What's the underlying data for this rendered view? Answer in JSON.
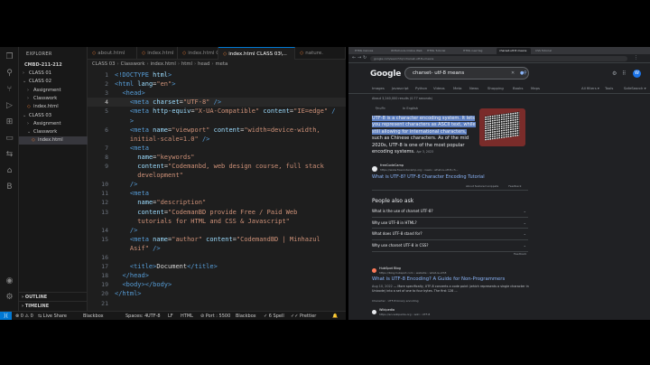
{
  "vscode": {
    "explorer_title": "EXPLORER",
    "folder_title": "CMBD-211-212",
    "tree": [
      {
        "label": "CLASS 01",
        "kind": "folder",
        "chev": "›"
      },
      {
        "label": "CLASS 02",
        "kind": "folder",
        "chev": "⌄"
      },
      {
        "label": "Assignment",
        "kind": "folder",
        "chev": "›"
      },
      {
        "label": "Classwork",
        "kind": "folder",
        "chev": "›"
      },
      {
        "label": "index.html",
        "kind": "file",
        "chev": ""
      },
      {
        "label": "CLASS 03",
        "kind": "folder",
        "chev": "⌄"
      },
      {
        "label": "Assignment",
        "kind": "folder",
        "chev": "›"
      },
      {
        "label": "Classwork",
        "kind": "folder",
        "chev": "⌄"
      },
      {
        "label": "index.html",
        "kind": "file",
        "chev": ""
      }
    ],
    "outline_label": "OUTLINE",
    "timeline_label": "TIMELINE",
    "tabs": [
      {
        "label": "about.html"
      },
      {
        "label": "index.html"
      },
      {
        "label": "index.html CLASS 03\\..."
      },
      {
        "label": "index.html CLASS 03\\..."
      },
      {
        "label": "nature."
      }
    ],
    "breadcrumb": [
      "CLASS 03",
      "Classwork",
      "index.html",
      "html",
      "head",
      "meta"
    ],
    "code_lines": [
      {
        "n": "1",
        "html": "<span class='tg'>&lt;!DOCTYPE</span> <span class='at'>html</span><span class='tg'>&gt;</span>"
      },
      {
        "n": "2",
        "html": "<span class='tg'>&lt;html</span> <span class='at'>lang</span><span class='tx'>=</span><span class='st'>\"en\"</span><span class='tg'>&gt;</span>"
      },
      {
        "n": "3",
        "html": "&nbsp;&nbsp;<span class='tg'>&lt;head&gt;</span>"
      },
      {
        "n": "4",
        "html": "&nbsp;&nbsp;&nbsp;&nbsp;<span class='tg'>&lt;meta</span> <span class='at'>charset</span><span class='tx'>=</span><span class='st'>\"UTF-8\"</span> <span class='tg'>/&gt;</span>"
      },
      {
        "n": "5",
        "html": "&nbsp;&nbsp;&nbsp;&nbsp;<span class='tg'>&lt;meta</span> <span class='at'>http-equiv</span><span class='tx'>=</span><span class='st'>\"X-UA-Compatible\"</span> <span class='at'>content</span><span class='tx'>=</span><span class='st'>\"IE=edge\"</span> <span class='tg'>/</span>"
      },
      {
        "n": "",
        "html": "&nbsp;&nbsp;&nbsp;&nbsp;<span class='tg'>&gt;</span>"
      },
      {
        "n": "6",
        "html": "&nbsp;&nbsp;&nbsp;&nbsp;<span class='tg'>&lt;meta</span> <span class='at'>name</span><span class='tx'>=</span><span class='st'>\"viewport\"</span> <span class='at'>content</span><span class='tx'>=</span><span class='st'>\"width=device-width,</span>"
      },
      {
        "n": "",
        "html": "&nbsp;&nbsp;&nbsp;&nbsp;<span class='st'>initial-scale=1.0\"</span> <span class='tg'>/&gt;</span>"
      },
      {
        "n": "7",
        "html": "&nbsp;&nbsp;&nbsp;&nbsp;<span class='tg'>&lt;meta</span>"
      },
      {
        "n": "8",
        "html": "&nbsp;&nbsp;&nbsp;&nbsp;&nbsp;&nbsp;<span class='at'>name</span><span class='tx'>=</span><span class='st'>\"keywords\"</span>"
      },
      {
        "n": "9",
        "html": "&nbsp;&nbsp;&nbsp;&nbsp;&nbsp;&nbsp;<span class='at'>content</span><span class='tx'>=</span><span class='st'>\"Codemanbd, web design course, full stack</span>"
      },
      {
        "n": "",
        "html": "&nbsp;&nbsp;&nbsp;&nbsp;&nbsp;&nbsp;<span class='st'>development\"</span>"
      },
      {
        "n": "10",
        "html": "&nbsp;&nbsp;&nbsp;&nbsp;<span class='tg'>/&gt;</span>"
      },
      {
        "n": "11",
        "html": "&nbsp;&nbsp;&nbsp;&nbsp;<span class='tg'>&lt;meta</span>"
      },
      {
        "n": "12",
        "html": "&nbsp;&nbsp;&nbsp;&nbsp;&nbsp;&nbsp;<span class='at'>name</span><span class='tx'>=</span><span class='st'>\"description\"</span>"
      },
      {
        "n": "13",
        "html": "&nbsp;&nbsp;&nbsp;&nbsp;&nbsp;&nbsp;<span class='at'>content</span><span class='tx'>=</span><span class='st'>\"CodemanBD provide Free / Paid Web</span>"
      },
      {
        "n": "",
        "html": "&nbsp;&nbsp;&nbsp;&nbsp;&nbsp;&nbsp;<span class='st'>tutorials for HTML and CSS &amp; Javascript\"</span>"
      },
      {
        "n": "14",
        "html": "&nbsp;&nbsp;&nbsp;&nbsp;<span class='tg'>/&gt;</span>"
      },
      {
        "n": "15",
        "html": "&nbsp;&nbsp;&nbsp;&nbsp;<span class='tg'>&lt;meta</span> <span class='at'>name</span><span class='tx'>=</span><span class='st'>\"author\"</span> <span class='at'>content</span><span class='tx'>=</span><span class='st'>\"CodemandBD | Minhazul</span>"
      },
      {
        "n": "",
        "html": "&nbsp;&nbsp;&nbsp;&nbsp;<span class='st'>Asif\"</span> <span class='tg'>/&gt;</span>"
      },
      {
        "n": "16",
        "html": ""
      },
      {
        "n": "17",
        "html": "&nbsp;&nbsp;&nbsp;&nbsp;<span class='tg'>&lt;title&gt;</span><span class='tx'>Document</span><span class='tg'>&lt;/title&gt;</span>"
      },
      {
        "n": "18",
        "html": "&nbsp;&nbsp;<span class='tg'>&lt;/head&gt;</span>"
      },
      {
        "n": "19",
        "html": "&nbsp;&nbsp;<span class='tg'>&lt;body&gt;&lt;/body&gt;</span>"
      },
      {
        "n": "20",
        "html": "<span class='tg'>&lt;/html&gt;</span>"
      },
      {
        "n": "21",
        "html": ""
      }
    ],
    "current_line": "4",
    "status": {
      "live_share": "Live Share",
      "blackbox": "Blackbox",
      "spaces": "Spaces: 4",
      "encoding": "UTF-8",
      "eol": "LF",
      "language": "HTML",
      "port": "Port : 5500",
      "blackbox2": "Blackbox",
      "spell": "6 Spell",
      "prettier": "Prettier"
    }
  },
  "browser": {
    "tabs": [
      "HTML Canvas",
      "W3Schools Online Web Tuto",
      "HTML Tutorial",
      "HTML new tag",
      "charset-utf-8 means",
      "CSS Tutorial"
    ],
    "active_tab_index": 4,
    "url": "google.com/search?q=charset-utf-8+means",
    "logo": "Google",
    "query": "charset- utf-8 means",
    "avatar_letter": "W",
    "filters": [
      "Images",
      "Javascript",
      "Python",
      "Videos",
      "Meta",
      "News",
      "Shopping",
      "Books",
      "Maps"
    ],
    "filters_right": [
      "All filters ▾",
      "Tools",
      "SafeSearch ▾"
    ],
    "stats": "About 3,240,000 results (0.77 seconds)",
    "sub_tabs": [
      "ইংরেজি",
      "In English"
    ],
    "snippet_pre_hl": "",
    "snippet_hl": "UTF-8 is a character encoding system. It lets you represent characters as ASCII text, while still allowing for international characters,",
    "snippet_post": " such as Chinese characters. As of the mid 2020s, UTF-8 is one of the most popular encoding systems.",
    "snippet_date": "Apr 3, 2023",
    "source_name": "freeCodeCamp",
    "source_url": "https://www.freecodecamp.org › news › what-is-utf-8-ch...",
    "featured_link": "What is UTF-8? UTF-8 Character Encoding Tutorial",
    "featured_feedback_a": "About featured snippets",
    "featured_feedback_b": "Feedback",
    "paa_title": "People also ask",
    "paa": [
      "What is the use of charset UTF-8?",
      "Why use UTF-8 in HTML?",
      "What does UTF-8 stand for?",
      "Why use charset UTF-8 in CSS?"
    ],
    "paa_feedback": "Feedback",
    "results": [
      {
        "name": "HubSpot Blog",
        "url": "https://blog.hubspot.com › website › what-is-utf-8",
        "title": "What is UTF-8 Encoding? A Guide for Non-Programmers",
        "date": "Aug 10, 2022",
        "snippet": " — More specifically, UTF-8 converts a code point (which represents a single character in Unicode) into a set of one to four bytes. The first 128 ...",
        "extra": "Character · UTF-8 binary encoding",
        "icon_color": "#ff7a59"
      },
      {
        "name": "Wikipedia",
        "url": "https://en.wikipedia.org › wiki › UTF-8",
        "title": "UTF-8",
        "date": "",
        "snippet": "",
        "extra": "",
        "icon_color": "#e8eaed"
      }
    ]
  }
}
